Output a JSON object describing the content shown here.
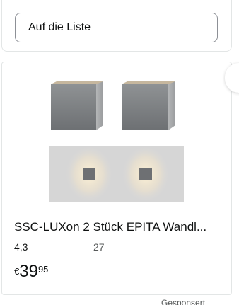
{
  "top_card": {
    "list_button_label": "Auf die Liste"
  },
  "product": {
    "title": "SSC-LUXon 2 Stück EPITA Wandl...",
    "rating": "4,3",
    "review_count": "27",
    "price_currency": "€",
    "price_whole": "39",
    "price_fraction": "95"
  },
  "footer": {
    "sponsored_label": "Gesponsert"
  },
  "colors": {
    "text": "#0f1111",
    "secondary_text": "#565959",
    "border": "#e3e6e6",
    "button_border": "#8d9096"
  },
  "icons": {
    "product_image": "wall-lamp-image"
  }
}
